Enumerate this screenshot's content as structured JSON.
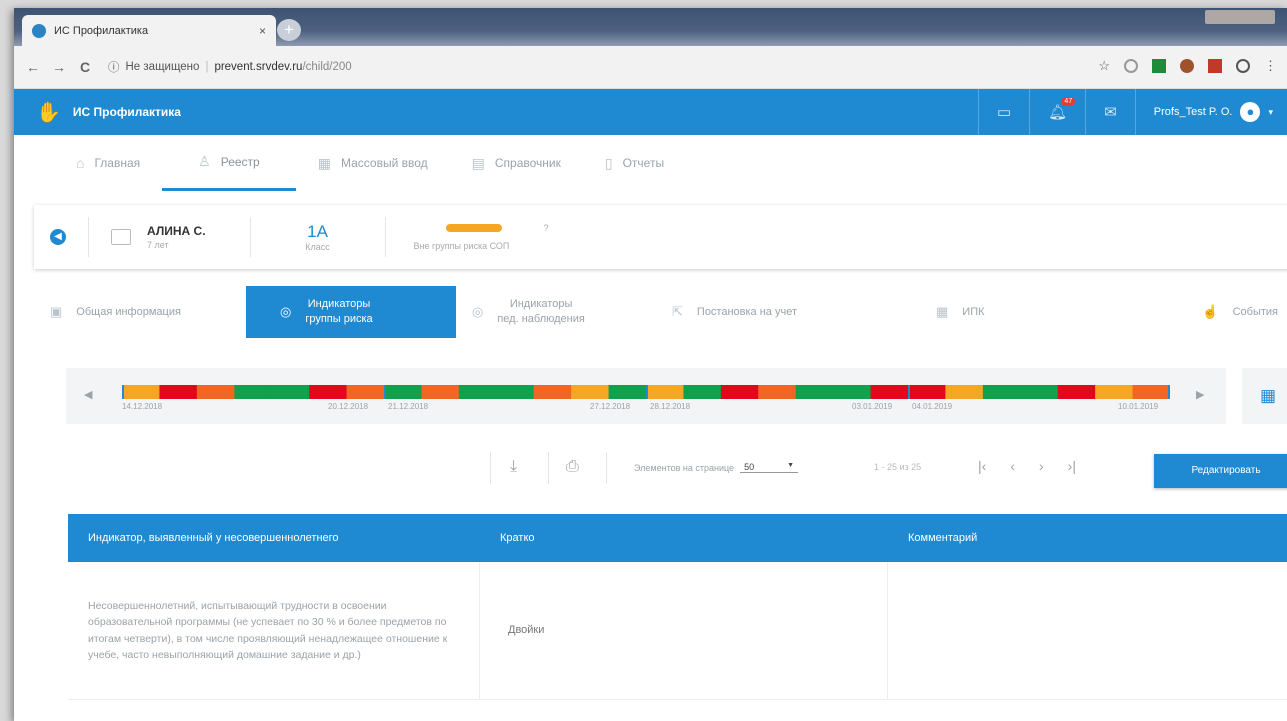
{
  "browser": {
    "tab_title": "ИС Профилактика",
    "tab_close": "×",
    "new_tab": "+",
    "back": "←",
    "forward": "→",
    "reload": "C",
    "security_icon": "ⓘ",
    "security_text": "Не защищено",
    "domain": "prevent.srvdev.ru",
    "path": "/child/200",
    "star": "☆",
    "menu": "⋮"
  },
  "header": {
    "app_name": "ИС Профилактика",
    "notifications_badge": "47",
    "user_name": "Profs_Test P. O.",
    "user_caret": "▾"
  },
  "main_menu": [
    {
      "label": "Главная",
      "icon": "home-icon"
    },
    {
      "label": "Реестр",
      "icon": "person-icon"
    },
    {
      "label": "Массовый ввод",
      "icon": "grid-icon"
    },
    {
      "label": "Справочник",
      "icon": "folder-icon"
    },
    {
      "label": "Отчеты",
      "icon": "document-icon"
    }
  ],
  "student": {
    "name": "АЛИНА С.",
    "age": "7 лет",
    "class_value": "1А",
    "class_label": "Класс",
    "risk_label": "Вне группы риска СОП",
    "risk_question": "?",
    "risk_color": "#f5a623"
  },
  "subtabs": [
    {
      "label": "Общая информация",
      "icon": "id-card-icon"
    },
    {
      "line1": "Индикаторы",
      "line2": "группы риска",
      "icon": "target-icon"
    },
    {
      "line1": "Индикаторы",
      "line2": "пед. наблюдения",
      "icon": "target-icon"
    },
    {
      "label": "Постановка на учет",
      "icon": "export-icon"
    },
    {
      "label": "ИПК",
      "icon": "calendar-icon"
    },
    {
      "label": "События",
      "icon": "hand-icon"
    }
  ],
  "timeline": {
    "prev": "◀",
    "next": "▶",
    "dates": [
      "14.12.2018",
      "20.12.2018",
      "21.12.2018",
      "27.12.2018",
      "28.12.2018",
      "03.01.2019",
      "04.01.2019",
      "10.01.2019"
    ],
    "segment_colors": [
      "#f5a623",
      "#e0081a",
      "#f26522",
      "#11a14c",
      "#11a14c",
      "#e0081a",
      "#f26522",
      "#11a14c",
      "#f26522",
      "#11a14c",
      "#11a14c",
      "#f26522",
      "#f5a623",
      "#11a14c",
      "#f5a623",
      "#11a14c",
      "#e0081a",
      "#f26522",
      "#11a14c",
      "#11a14c",
      "#e0081a",
      "#e0081a",
      "#f5a623",
      "#11a14c",
      "#11a14c",
      "#e0081a",
      "#f5a623",
      "#f26522"
    ]
  },
  "toolbar": {
    "perpage_label": "Элементов на странице",
    "perpage_value": "50",
    "perpage_caret": "▼",
    "page_info": "1 - 25 из 25",
    "first": "|‹",
    "prev": "‹",
    "next": "›",
    "last": "›|",
    "edit_label": "Редактировать"
  },
  "table": {
    "headers": [
      "Индикатор, выявленный у несовершеннолетнего",
      "Кратко",
      "Комментарий"
    ],
    "rows": [
      {
        "indicator": "Несовершеннолетний, испытывающий трудности в освоении образовательной программы (не успевает по 30 % и более предметов по итогам четверти), в том числе проявляющий ненадлежащее отношение к учебе, часто невыполняющий домашние задание и др.)",
        "short": "Двойки",
        "comment": ""
      }
    ]
  }
}
